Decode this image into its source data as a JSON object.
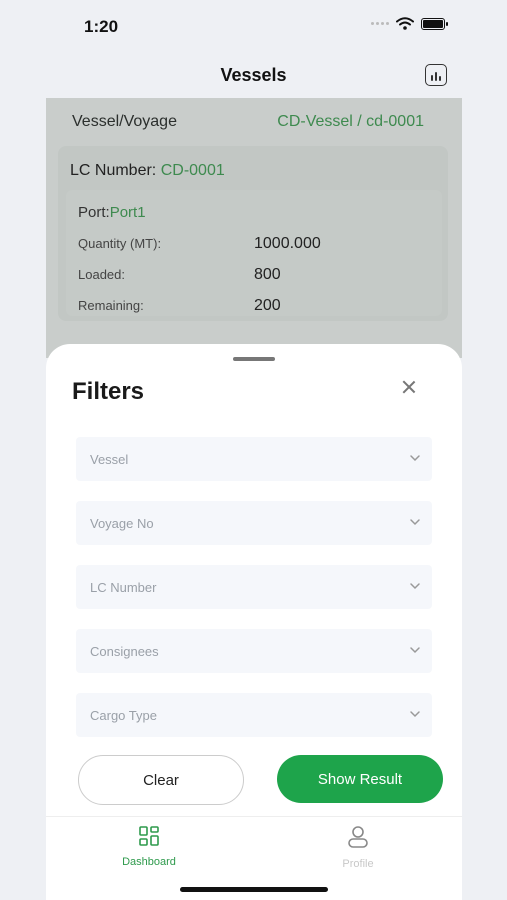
{
  "status": {
    "time": "1:20"
  },
  "nav": {
    "title": "Vessels",
    "chart_icon": "bar-chart-icon"
  },
  "background_card": {
    "vessel_voyage_label": "Vessel/Voyage",
    "vessel_voyage_value": "CD-Vessel / cd-0001",
    "lc_label": "LC Number:",
    "lc_value": "CD-0001",
    "port_label": "Port:",
    "port_value": "Port1",
    "rows": [
      {
        "label": "Quantity (MT):",
        "value": "1000.000"
      },
      {
        "label": "Loaded:",
        "value": "800"
      },
      {
        "label": "Remaining:",
        "value": "200"
      }
    ]
  },
  "filters": {
    "title": "Filters",
    "dropdowns": [
      {
        "placeholder": "Vessel"
      },
      {
        "placeholder": "Voyage No"
      },
      {
        "placeholder": "LC Number"
      },
      {
        "placeholder": "Consignees"
      },
      {
        "placeholder": "Cargo Type"
      }
    ],
    "clear_label": "Clear",
    "show_label": "Show Result"
  },
  "tabs": [
    {
      "label": "Dashboard",
      "icon": "dashboard-grid-icon",
      "active": true
    },
    {
      "label": "Profile",
      "icon": "person-icon",
      "active": false
    }
  ],
  "colors": {
    "accent": "#1ea44b",
    "green_text": "#3e8a4f"
  }
}
